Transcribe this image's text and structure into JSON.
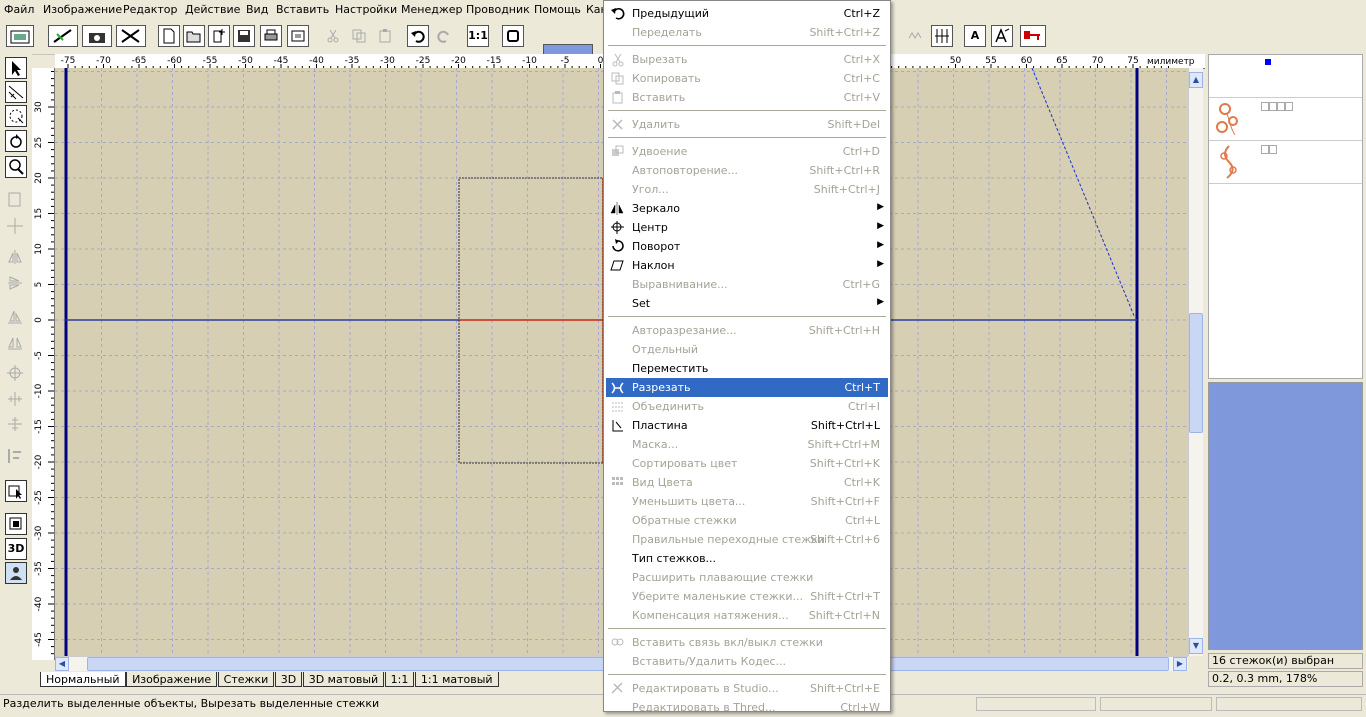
{
  "menubar": [
    "Файл",
    "Изображение",
    "Редактор",
    "Действие",
    "Вид",
    "Вставить",
    "Настройки",
    "Менеджер",
    "Проводник",
    "Помощь",
    "Кан"
  ],
  "ruler": {
    "top_ticks": [
      "-75",
      "-70",
      "-65",
      "-60",
      "-55",
      "-50",
      "-45",
      "-40",
      "-35",
      "-30",
      "-25",
      "-20",
      "-15",
      "-10",
      "-5",
      "0",
      "50",
      "55",
      "60",
      "65",
      "70",
      "75"
    ],
    "unit": "милиметр",
    "left_ticks": [
      "30",
      "25",
      "20",
      "15",
      "10",
      "5",
      "0",
      "-5",
      "-10",
      "-15",
      "-20",
      "-25",
      "-30",
      "-35",
      "-40",
      "-45"
    ]
  },
  "toolbar": {
    "zoom_1to1": "1:1",
    "btn_text_a": "A",
    "colors": {
      "canvas": "#d6cfb3",
      "accent": "#7f97db",
      "highlight": "#316ac5"
    }
  },
  "left_tools": {
    "btn_3d": "3D"
  },
  "context_menu": [
    {
      "label": "Предыдущий",
      "shortcut": "Ctrl+Z",
      "disabled": false,
      "icon": "undo-icon"
    },
    {
      "label": "Переделать",
      "shortcut": "Shift+Ctrl+Z",
      "disabled": true
    },
    {
      "sep": true
    },
    {
      "label": "Вырезать",
      "shortcut": "Ctrl+X",
      "disabled": true,
      "icon": "cut-icon"
    },
    {
      "label": "Копировать",
      "shortcut": "Ctrl+C",
      "disabled": true,
      "icon": "copy-icon"
    },
    {
      "label": "Вставить",
      "shortcut": "Ctrl+V",
      "disabled": true,
      "icon": "paste-icon"
    },
    {
      "sep": true
    },
    {
      "label": "Удалить",
      "shortcut": "Shift+Del",
      "disabled": true,
      "icon": "delete-icon"
    },
    {
      "sep": true
    },
    {
      "label": "Удвоение",
      "shortcut": "Ctrl+D",
      "disabled": true,
      "icon": "duplicate-icon"
    },
    {
      "label": "Автоповторение...",
      "shortcut": "Shift+Ctrl+R",
      "disabled": true
    },
    {
      "label": "Угол...",
      "shortcut": "Shift+Ctrl+J",
      "disabled": true
    },
    {
      "label": "Зеркало",
      "arrow": true,
      "disabled": false,
      "icon": "mirror-icon"
    },
    {
      "label": "Центр",
      "arrow": true,
      "disabled": false,
      "icon": "center-icon"
    },
    {
      "label": "Поворот",
      "arrow": true,
      "disabled": false,
      "icon": "rotate-icon"
    },
    {
      "label": "Наклон",
      "arrow": true,
      "disabled": false,
      "icon": "slant-icon"
    },
    {
      "label": "Выравнивание...",
      "shortcut": "Ctrl+G",
      "disabled": true
    },
    {
      "label": "Set",
      "arrow": true,
      "disabled": false
    },
    {
      "sep": true
    },
    {
      "label": "Авторазрезание...",
      "shortcut": "Shift+Ctrl+H",
      "disabled": true
    },
    {
      "label": "Отдельный",
      "disabled": true
    },
    {
      "label": "Переместить",
      "disabled": false
    },
    {
      "label": "Разрезать",
      "shortcut": "Ctrl+T",
      "disabled": false,
      "highlighted": true,
      "icon": "split-icon"
    },
    {
      "label": "Объединить",
      "shortcut": "Ctrl+I",
      "disabled": true,
      "icon": "combine-icon"
    },
    {
      "label": "Пластина",
      "shortcut": "Shift+Ctrl+L",
      "disabled": false,
      "icon": "plate-icon"
    },
    {
      "label": "Маска...",
      "shortcut": "Shift+Ctrl+M",
      "disabled": true
    },
    {
      "label": "Сортировать цвет",
      "shortcut": "Shift+Ctrl+K",
      "disabled": true
    },
    {
      "label": "Вид Цвета",
      "shortcut": "Ctrl+K",
      "disabled": true,
      "icon": "color-view-icon"
    },
    {
      "label": "Уменьшить цвета...",
      "shortcut": "Shift+Ctrl+F",
      "disabled": true
    },
    {
      "label": "Обратные стежки",
      "shortcut": "Ctrl+L",
      "disabled": true
    },
    {
      "label": "Правильные переходные стежки",
      "shortcut": "Shift+Ctrl+6",
      "disabled": true
    },
    {
      "label": "Тип стежков...",
      "disabled": false
    },
    {
      "label": "Расширить плавающие стежки",
      "disabled": true
    },
    {
      "label": "Уберите маленькие стежки...",
      "shortcut": "Shift+Ctrl+T",
      "disabled": true
    },
    {
      "label": "Компенсация натяжения...",
      "shortcut": "Shift+Ctrl+N",
      "disabled": true
    },
    {
      "sep": true
    },
    {
      "label": "Вставить связь вкл/выкл стежки",
      "disabled": true,
      "icon": "link-icon"
    },
    {
      "label": "Вставить/Удалить Кодес...",
      "disabled": true
    },
    {
      "sep": true
    },
    {
      "label": "Редактировать в Studio...",
      "shortcut": "Shift+Ctrl+E",
      "disabled": true,
      "icon": "edit-studio-icon"
    },
    {
      "label": "Редактировать в Thred...",
      "shortcut": "Ctrl+W",
      "disabled": true
    }
  ],
  "tabs": [
    "Нормальный",
    "Изображение",
    "Стежки",
    "3D",
    "3D матовый",
    "1:1",
    "1:1 матовый"
  ],
  "status": {
    "text": "Разделить выделенные объекты, Вырезать выделенные стежки",
    "selection": "16 стежок(и) выбран",
    "position": "0.2, 0.3 mm, 178%"
  }
}
